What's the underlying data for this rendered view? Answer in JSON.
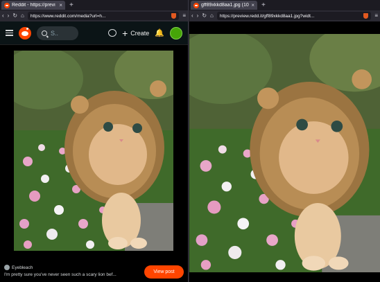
{
  "left": {
    "tab_title": "Reddit - https://previ",
    "tab_close": "×",
    "new_tab": "+",
    "url": "https://www.reddit.com/media?url=h...",
    "nav": {
      "back": "‹",
      "forward": "›",
      "reload": "↻",
      "home": "⌂"
    },
    "search_placeholder": "S..",
    "create_label": "Create",
    "create_plus": "+",
    "username": "Eyebleach",
    "caption": "I'm pretty sure you've never seen such a scary lion bef...",
    "view_post_label": "View post"
  },
  "right": {
    "tab_title": "gff89xkkd8aa1.jpg (10",
    "tab_close": "×",
    "new_tab": "+",
    "url": "https://preview.redd.it/gff89xkkd8aa1.jpg?widt...",
    "nav": {
      "back": "‹",
      "forward": "›",
      "reload": "↻",
      "home": "⌂"
    }
  },
  "colors": {
    "reddit_orange": "#ff4500",
    "browser_chrome": "#2b2a33",
    "reddit_bg": "#0b1416"
  },
  "icons": [
    "reddit-logo-icon",
    "menu-icon",
    "search-icon",
    "chat-icon",
    "plus-icon",
    "bell-icon",
    "avatar",
    "brave-shield-icon"
  ]
}
